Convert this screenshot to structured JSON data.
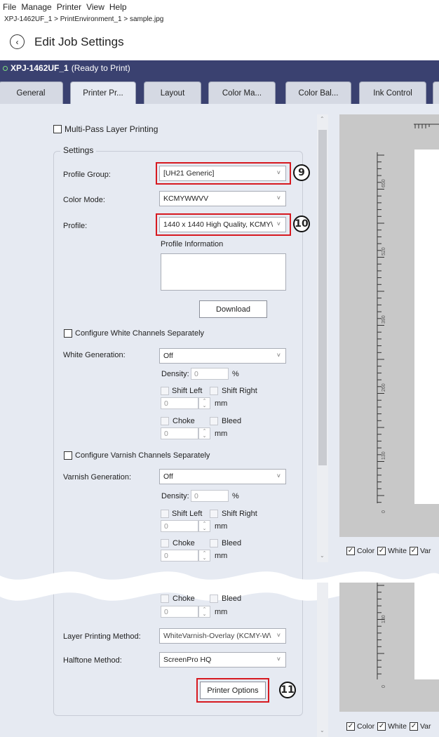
{
  "menu": [
    "File",
    "Manage",
    "Printer",
    "View",
    "Help"
  ],
  "breadcrumb": "XPJ-1462UF_1 > PrintEnvironment_1 > sample.jpg",
  "page_title": "Edit Job Settings",
  "printer": {
    "name": "XPJ-1462UF_1",
    "status": "(Ready to Print)"
  },
  "tabs": [
    "General",
    "Printer Pr...",
    "Layout",
    "Color Ma...",
    "Color Bal...",
    "Ink Control"
  ],
  "multipass": {
    "label": "Multi-Pass Layer Printing"
  },
  "settings": {
    "legend": "Settings",
    "profile_group_label": "Profile Group:",
    "profile_group_value": "[UH21 Generic]",
    "color_mode_label": "Color Mode:",
    "color_mode_value": "KCMYWWVV",
    "profile_label": "Profile:",
    "profile_value": "1440 x 1440 High Quality, KCMY\\",
    "profile_info_label": "Profile Information",
    "download_label": "Download"
  },
  "white": {
    "configure_label": "Configure White Channels Separately",
    "generation_label": "White Generation:",
    "generation_value": "Off",
    "density_label": "Density:",
    "density_value": "0",
    "density_unit": "%",
    "shift_left": "Shift Left",
    "shift_right": "Shift Right",
    "shift_value": "0",
    "shift_unit": "mm",
    "choke": "Choke",
    "bleed": "Bleed",
    "choke_value": "0",
    "choke_unit": "mm"
  },
  "varnish": {
    "configure_label": "Configure Varnish Channels Separately",
    "generation_label": "Varnish Generation:",
    "generation_value": "Off",
    "density_label": "Density:",
    "density_value": "0",
    "density_unit": "%",
    "shift_left": "Shift Left",
    "shift_right": "Shift Right",
    "shift_value": "0",
    "shift_unit": "mm",
    "choke": "Choke",
    "bleed": "Bleed",
    "choke_value": "0",
    "choke_unit": "mm"
  },
  "lower": {
    "choke_partial": "Choke",
    "bleed": "Bleed",
    "choke_value": "0",
    "choke_unit": "mm",
    "layer_method_label": "Layer Printing Method:",
    "layer_method_value": "WhiteVarnish-Overlay (KCMY-W\\",
    "halftone_label": "Halftone Method:",
    "halftone_value": "ScreenPro HQ",
    "printer_options_label": "Printer Options"
  },
  "callouts": [
    "9",
    "10",
    "11"
  ],
  "preview": {
    "ruler_labels_top": [
      "650",
      "520",
      "390",
      "260",
      "130",
      "0"
    ],
    "ruler_labels_bottom": [
      "130",
      "0"
    ],
    "toggles": [
      "Color",
      "White",
      "Var"
    ]
  },
  "colors": {
    "accent_bar": "#3a4170",
    "highlight": "#d71920",
    "panel": "#e6eaf2"
  }
}
